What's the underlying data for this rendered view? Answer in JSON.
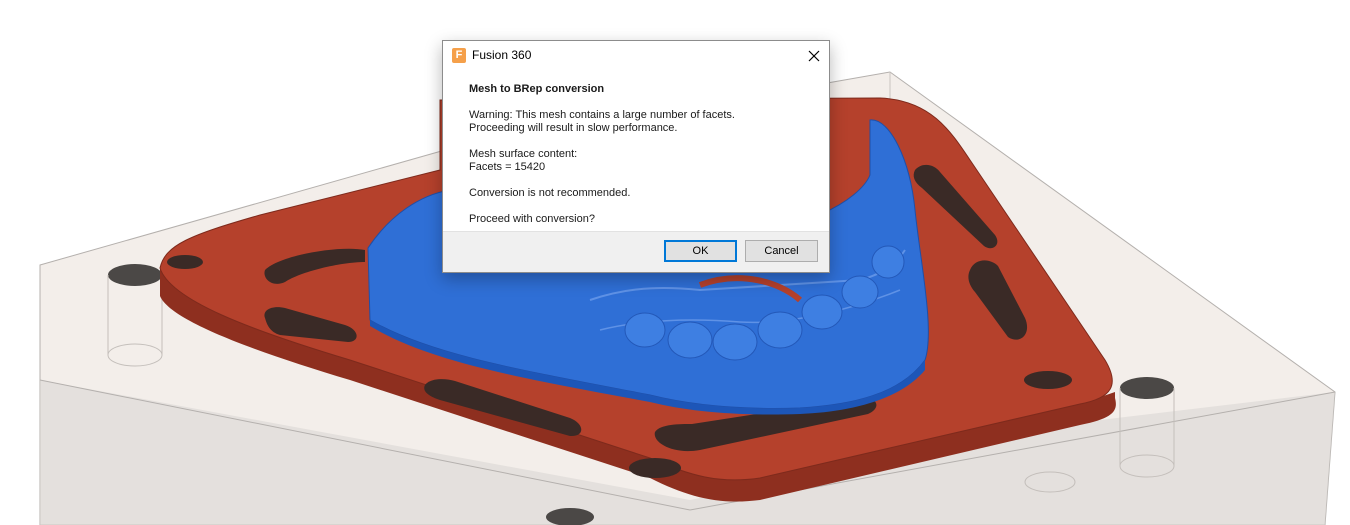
{
  "dialog": {
    "title": "Fusion 360",
    "heading": "Mesh to BRep conversion",
    "warning_line1": "Warning: This mesh contains a large number of facets.",
    "warning_line2": "Proceeding will result in slow performance.",
    "content_label": "Mesh surface content:",
    "facets": "Facets = 15420",
    "recommendation": "Conversion is not recommended.",
    "question": "Proceed with conversion?",
    "ok_label": "OK",
    "cancel_label": "Cancel"
  },
  "icons": {
    "app": "fusion-360-app-icon",
    "close": "close-icon"
  },
  "colors": {
    "fixture_plate": "#b5412c",
    "mesh_model": "#2f6fd6",
    "primary_button_border": "#0078d7"
  }
}
